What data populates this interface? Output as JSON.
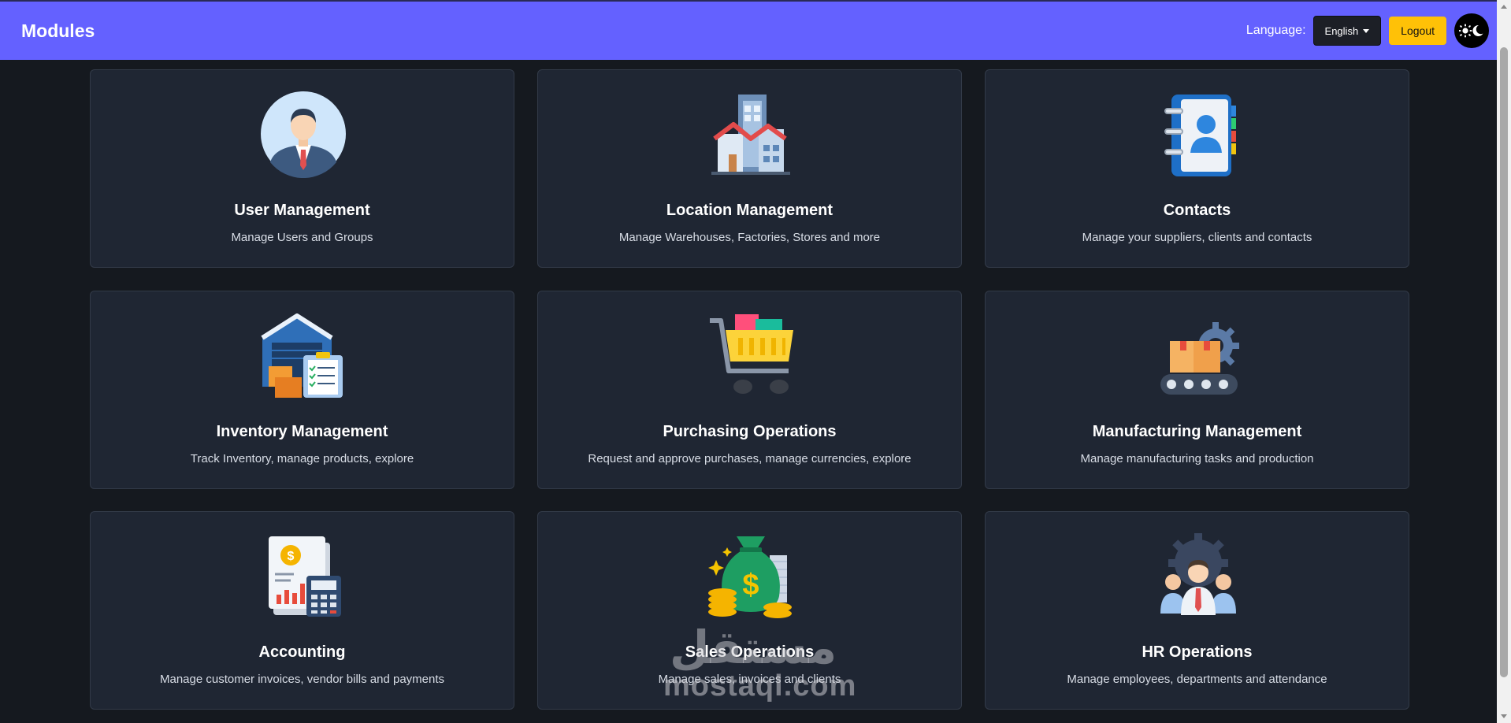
{
  "header": {
    "title": "Modules",
    "language_label": "Language:",
    "language_value": "English",
    "logout_label": "Logout"
  },
  "modules": [
    {
      "title": "User Management",
      "description": "Manage Users and Groups",
      "icon": "user-manager-icon"
    },
    {
      "title": "Location Management",
      "description": "Manage Warehouses, Factories, Stores and more",
      "icon": "building-icon"
    },
    {
      "title": "Contacts",
      "description": "Manage your suppliers, clients and contacts",
      "icon": "address-book-icon"
    },
    {
      "title": "Inventory Management",
      "description": "Track Inventory, manage products, explore",
      "icon": "warehouse-icon"
    },
    {
      "title": "Purchasing Operations",
      "description": "Request and approve purchases, manage currencies, explore",
      "icon": "shopping-cart-icon"
    },
    {
      "title": "Manufacturing Management",
      "description": "Manage manufacturing tasks and production",
      "icon": "conveyor-gear-icon"
    },
    {
      "title": "Accounting",
      "description": "Manage customer invoices, vendor bills and payments",
      "icon": "calculator-report-icon"
    },
    {
      "title": "Sales Operations",
      "description": "Manage sales, invoices and clients",
      "icon": "money-bag-icon"
    },
    {
      "title": "HR Operations",
      "description": "Manage employees, departments and attendance",
      "icon": "team-gear-icon"
    }
  ],
  "watermark": {
    "arabic": "مستقل",
    "latin": "mostaql.com"
  },
  "colors": {
    "header_bg": "#6461ff",
    "page_bg": "#15191f",
    "card_bg": "#1f2633",
    "logout_bg": "#ffc107"
  }
}
